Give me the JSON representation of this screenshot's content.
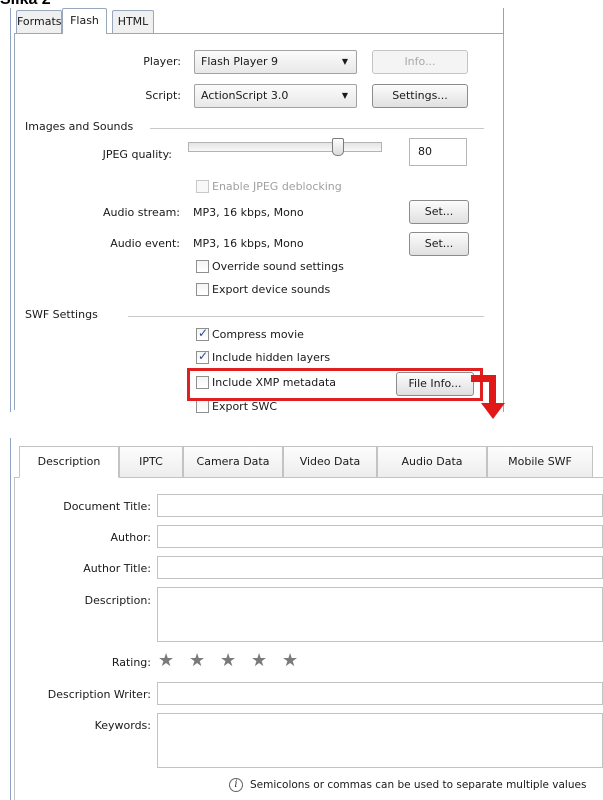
{
  "page_caption": "Slika 2",
  "flash_settings": {
    "tabs": [
      {
        "label": "Formats"
      },
      {
        "label": "Flash"
      },
      {
        "label": "HTML"
      }
    ],
    "active_tab": "Flash",
    "player": {
      "label": "Player:",
      "value": "Flash Player 9",
      "info_button": "Info..."
    },
    "script": {
      "label": "Script:",
      "value": "ActionScript 3.0",
      "settings_button": "Settings..."
    },
    "images_sounds": {
      "section_title": "Images and Sounds",
      "jpeg_quality": {
        "label": "JPEG quality:",
        "value": "80",
        "slider_fraction": 0.8
      },
      "enable_jpeg_deblocking": {
        "label": "Enable JPEG deblocking",
        "checked": false,
        "disabled": true
      },
      "audio_stream": {
        "label": "Audio stream:",
        "value": "MP3, 16 kbps, Mono",
        "button": "Set..."
      },
      "audio_event": {
        "label": "Audio event:",
        "value": "MP3, 16 kbps, Mono",
        "button": "Set..."
      },
      "override_sound": {
        "label": "Override sound settings",
        "checked": false
      },
      "export_device_sounds": {
        "label": "Export device sounds",
        "checked": false
      }
    },
    "swf_settings": {
      "section_title": "SWF Settings",
      "compress_movie": {
        "label": "Compress movie",
        "checked": true
      },
      "include_hidden_layers": {
        "label": "Include hidden layers",
        "checked": true
      },
      "include_xmp_metadata": {
        "label": "Include XMP metadata",
        "checked": false
      },
      "file_info_button": "File Info...",
      "export_swc": {
        "label": "Export SWC",
        "checked": false
      }
    },
    "highlight_color": "#e02020"
  },
  "file_info": {
    "tabs": [
      {
        "label": "Description"
      },
      {
        "label": "IPTC"
      },
      {
        "label": "Camera Data"
      },
      {
        "label": "Video Data"
      },
      {
        "label": "Audio Data"
      },
      {
        "label": "Mobile SWF"
      }
    ],
    "active_tab": "Description",
    "fields": {
      "document_title": {
        "label": "Document Title:",
        "value": ""
      },
      "author": {
        "label": "Author:",
        "value": ""
      },
      "author_title": {
        "label": "Author Title:",
        "value": ""
      },
      "description": {
        "label": "Description:",
        "value": ""
      },
      "rating": {
        "label": "Rating:",
        "stars": 5,
        "filled": 0
      },
      "description_writer": {
        "label": "Description Writer:",
        "value": ""
      },
      "keywords": {
        "label": "Keywords:",
        "value": ""
      }
    },
    "hint": "Semicolons or commas can be used to separate multiple values"
  }
}
